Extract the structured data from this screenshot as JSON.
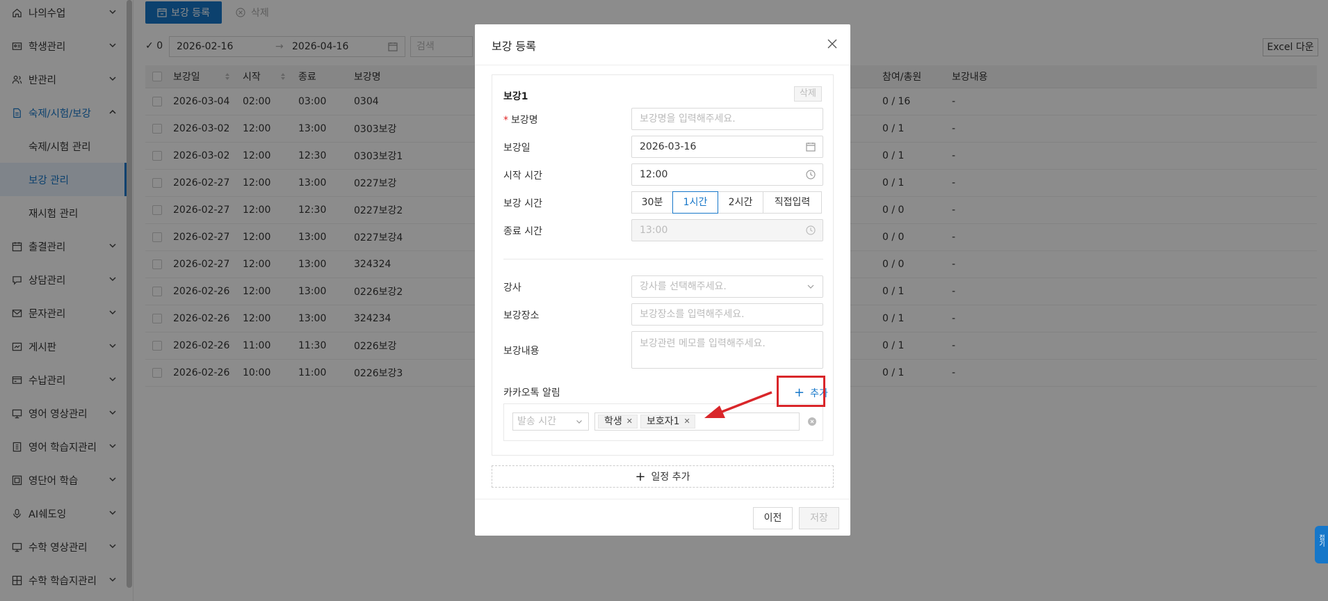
{
  "sidebar": {
    "items": [
      {
        "label": "나의수업",
        "icon": "home-icon"
      },
      {
        "label": "학생관리",
        "icon": "id-card-icon"
      },
      {
        "label": "반관리",
        "icon": "users-icon"
      },
      {
        "label": "숙제/시험/보강",
        "icon": "document-icon"
      },
      {
        "label": "출결관리",
        "icon": "calendar-icon"
      },
      {
        "label": "상담관리",
        "icon": "chat-icon"
      },
      {
        "label": "문자관리",
        "icon": "mail-icon"
      },
      {
        "label": "게시판",
        "icon": "board-icon"
      },
      {
        "label": "수납관리",
        "icon": "wallet-icon"
      },
      {
        "label": "영어 영상관리",
        "icon": "monitor-icon"
      },
      {
        "label": "영어 학습지관리",
        "icon": "book-icon"
      },
      {
        "label": "영단어 학습",
        "icon": "vocab-icon"
      },
      {
        "label": "AI쉐도잉",
        "icon": "mic-icon"
      },
      {
        "label": "수학 영상관리",
        "icon": "monitor-icon"
      },
      {
        "label": "수학 학습지관리",
        "icon": "grid-icon"
      }
    ],
    "sub_items": [
      "숙제/시험 관리",
      "보강 관리",
      "재시험 관리"
    ]
  },
  "toolbar": {
    "register_label": "보강 등록",
    "delete_label": "삭제",
    "selected_count": "0",
    "date_from": "2026-02-16",
    "date_to": "2026-04-16",
    "search_placeholder": "검색",
    "excel_label": "Excel 다운"
  },
  "table": {
    "headers": [
      "보강일",
      "시작",
      "종료",
      "보강명",
      "참여/총원",
      "보강내용"
    ],
    "rows": [
      [
        "2026-03-04",
        "02:00",
        "03:00",
        "0304",
        "0 / 16",
        "-"
      ],
      [
        "2026-03-02",
        "12:00",
        "13:00",
        "0303보강",
        "0 / 1",
        "-"
      ],
      [
        "2026-03-02",
        "12:00",
        "12:30",
        "0303보강1",
        "0 / 1",
        "-"
      ],
      [
        "2026-02-27",
        "12:00",
        "13:00",
        "0227보강",
        "0 / 1",
        "-"
      ],
      [
        "2026-02-27",
        "12:00",
        "12:30",
        "0227보강2",
        "0 / 0",
        "-"
      ],
      [
        "2026-02-27",
        "12:00",
        "13:00",
        "0227보강4",
        "0 / 0",
        "-"
      ],
      [
        "2026-02-27",
        "12:00",
        "13:00",
        "324324",
        "0 / 0",
        "-"
      ],
      [
        "2026-02-26",
        "12:00",
        "13:00",
        "0226보강2",
        "0 / 1",
        "-"
      ],
      [
        "2026-02-26",
        "12:00",
        "13:00",
        "324234",
        "0 / 1",
        "-"
      ],
      [
        "2026-02-26",
        "11:00",
        "11:30",
        "0226보강",
        "0 / 1",
        "-"
      ],
      [
        "2026-02-26",
        "10:00",
        "11:00",
        "0226보강3",
        "0 / 1",
        "-"
      ]
    ]
  },
  "modal": {
    "title": "보강 등록",
    "card_title": "보강1",
    "card_delete": "삭제",
    "fields": {
      "name_label": "보강명",
      "name_required_mark": "*",
      "name_placeholder": "보강명을 입력해주세요.",
      "date_label": "보강일",
      "date_value": "2026-03-16",
      "start_label": "시작 시간",
      "start_value": "12:00",
      "duration_label": "보강 시간",
      "duration_options": [
        "30분",
        "1시간",
        "2시간",
        "직접입력"
      ],
      "duration_selected": "1시간",
      "end_label": "종료 시간",
      "end_value": "13:00",
      "teacher_label": "강사",
      "teacher_placeholder": "강사를 선택해주세요.",
      "place_label": "보강장소",
      "place_placeholder": "보강장소를 입력해주세요.",
      "content_label": "보강내용",
      "content_placeholder": "보강관련 메모를 입력해주세요.",
      "kakao_label": "카카오톡 알림",
      "kakao_add": "추가",
      "send_time_placeholder": "발송 시간",
      "recipients": [
        "학생",
        "보호자1"
      ]
    },
    "add_schedule": "일정 추가",
    "prev_label": "이전",
    "save_label": "저장"
  },
  "float_tab": "접기",
  "colors": {
    "accent": "#1677c9",
    "highlight": "#d9262a"
  }
}
